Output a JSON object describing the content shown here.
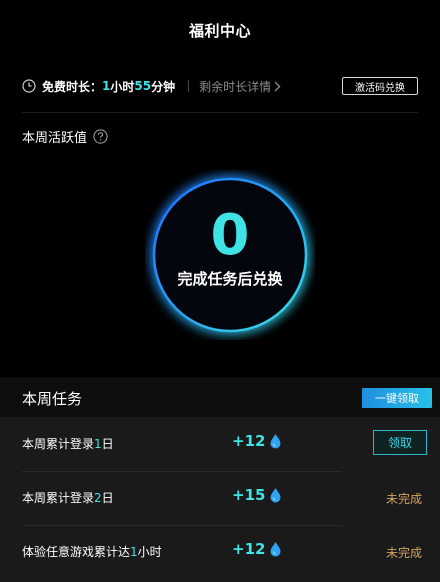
{
  "header": {
    "title": "福利中心"
  },
  "free_time": {
    "label": "免费时长：",
    "hours": "1",
    "hours_unit": "小时",
    "minutes": "55",
    "minutes_unit": "分钟",
    "detail_link": "剩余时长详情",
    "redeem_button": "激活码兑换"
  },
  "weekly_activity": {
    "label": "本周活跃值",
    "value": "0",
    "caption": "完成任务后兑换"
  },
  "weekly_tasks": {
    "label": "本周任务",
    "claim_all_button": "一键领取",
    "tasks": [
      {
        "name_pre": "本周累计登录",
        "name_num": "1",
        "name_post": "日",
        "reward": "+12",
        "action": "领取",
        "type": "button"
      },
      {
        "name_pre": "本周累计登录",
        "name_num": "2",
        "name_post": "日",
        "reward": "+15",
        "action": "未完成",
        "type": "status"
      },
      {
        "name_pre": "体验任意游戏累计达",
        "name_num": "1",
        "name_post": "小时",
        "reward": "+12",
        "action": "未完成",
        "type": "status"
      }
    ]
  },
  "colors": {
    "accent": "#3fe3e3",
    "ring_blue": "#1f6fff",
    "incomplete": "#d3a35f",
    "claim_btn": "#1f8fe0"
  },
  "icons": {
    "clock": "clock-icon",
    "help": "question-icon",
    "reward": "drop-icon",
    "chevron": "chevron-right-icon"
  }
}
